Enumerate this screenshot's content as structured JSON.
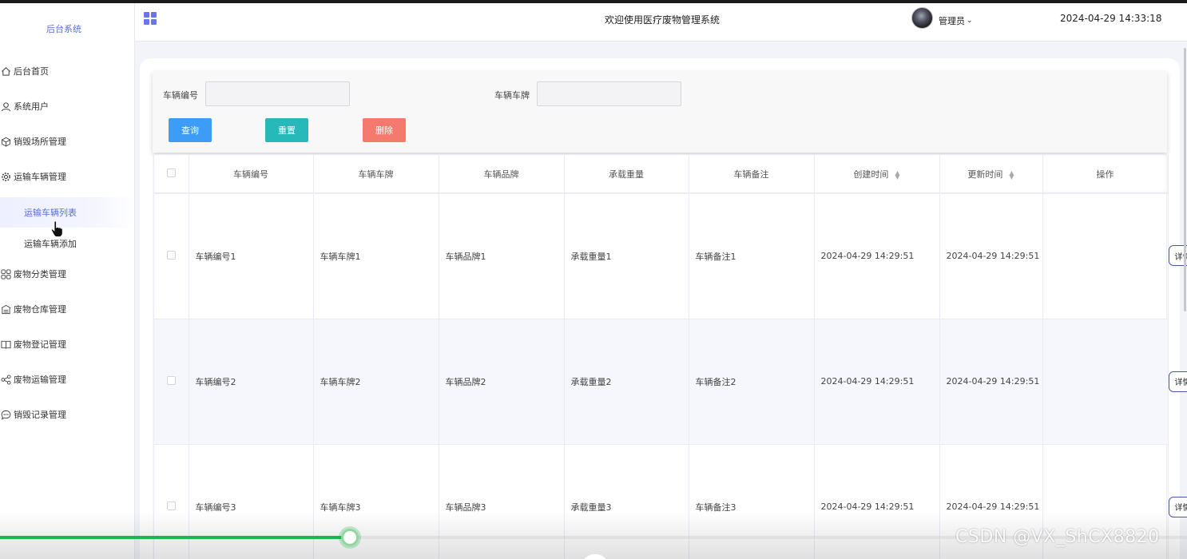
{
  "sidebar": {
    "brand": "后台系统",
    "menu": [
      {
        "label": "后台首页",
        "icon": "home-icon"
      },
      {
        "label": "系统用户",
        "icon": "user-icon"
      },
      {
        "label": "销毁场所管理",
        "icon": "cube-icon"
      },
      {
        "label": "运输车辆管理",
        "icon": "gear-icon"
      },
      {
        "label": "废物分类管理",
        "icon": "grid-icon"
      },
      {
        "label": "废物仓库管理",
        "icon": "warehouse-icon"
      },
      {
        "label": "废物登记管理",
        "icon": "book-icon"
      },
      {
        "label": "废物运输管理",
        "icon": "share-icon"
      },
      {
        "label": "销毁记录管理",
        "icon": "chat-icon"
      }
    ],
    "submenu": [
      {
        "label": "运输车辆列表",
        "active": true
      },
      {
        "label": "运输车辆添加",
        "active": false
      }
    ]
  },
  "header": {
    "title": "欢迎使用医疗废物管理系统",
    "user": "管理员",
    "datetime": "2024-04-29 14:33:18"
  },
  "search": {
    "field1_label": "车辆编号",
    "field1_value": "",
    "field2_label": "车辆车牌",
    "field2_value": "",
    "query_label": "查询",
    "reset_label": "重置",
    "delete_label": "删除"
  },
  "table": {
    "columns": [
      "车辆编号",
      "车辆车牌",
      "车辆品牌",
      "承载重量",
      "车辆备注",
      "创建时间",
      "更新时间",
      "操作"
    ],
    "rows": [
      {
        "code": "车辆编号1",
        "plate": "车辆车牌1",
        "brand": "车辆品牌1",
        "weight": "承载重量1",
        "note": "车辆备注1",
        "created": "2024-04-29 14:29:51",
        "updated": "2024-04-29 14:29:51",
        "action": "详情"
      },
      {
        "code": "车辆编号2",
        "plate": "车辆车牌2",
        "brand": "车辆品牌2",
        "weight": "承载重量2",
        "note": "车辆备注2",
        "created": "2024-04-29 14:29:51",
        "updated": "2024-04-29 14:29:51",
        "action": "详情"
      },
      {
        "code": "车辆编号3",
        "plate": "车辆车牌3",
        "brand": "车辆品牌3",
        "weight": "承载重量3",
        "note": "车辆备注3",
        "created": "2024-04-29 14:29:51",
        "updated": "2024-04-29 14:29:51",
        "action": "详情"
      }
    ]
  },
  "player": {
    "progress_fraction": 0.295
  },
  "watermark": "CSDN @VX_ShCX8820",
  "colors": {
    "accent": "#5b6fd6",
    "query": "#3d9cf5",
    "reset": "#27b9b9",
    "delete": "#f57a6e",
    "progress": "#1fb54a"
  }
}
